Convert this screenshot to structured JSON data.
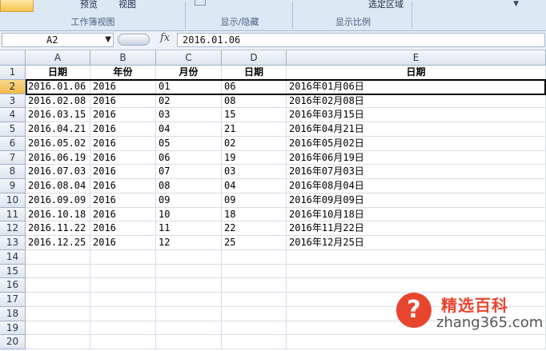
{
  "ribbon": {
    "groups": [
      {
        "label": "工作簿视图",
        "buttons": [
          "预览",
          "视图"
        ]
      },
      {
        "label": "显示/隐藏",
        "buttons": [
          ""
        ]
      },
      {
        "label": "显示比例",
        "buttons": [
          "选定区域"
        ]
      }
    ]
  },
  "formula_bar": {
    "name_box": "A2",
    "fx": "fx",
    "formula": "2016.01.06"
  },
  "columns": [
    "A",
    "B",
    "C",
    "D",
    "E"
  ],
  "row_numbers": [
    "1",
    "2",
    "3",
    "4",
    "5",
    "6",
    "7",
    "8",
    "9",
    "10",
    "11",
    "12",
    "13",
    "14",
    "15",
    "16",
    "17",
    "18",
    "19",
    "20"
  ],
  "header_row": [
    "日期",
    "年份",
    "月份",
    "日期",
    "日期"
  ],
  "data_rows": [
    [
      "2016.01.06",
      "2016",
      "01",
      "06",
      "2016年01月06日"
    ],
    [
      "2016.02.08",
      "2016",
      "02",
      "08",
      "2016年02月08日"
    ],
    [
      "2016.03.15",
      "2016",
      "03",
      "15",
      "2016年03月15日"
    ],
    [
      "2016.04.21",
      "2016",
      "04",
      "21",
      "2016年04月21日"
    ],
    [
      "2016.05.02",
      "2016",
      "05",
      "02",
      "2016年05月02日"
    ],
    [
      "2016.06.19",
      "2016",
      "06",
      "19",
      "2016年06月19日"
    ],
    [
      "2016.07.03",
      "2016",
      "07",
      "03",
      "2016年07月03日"
    ],
    [
      "2016.08.04",
      "2016",
      "08",
      "04",
      "2016年08月04日"
    ],
    [
      "2016.09.09",
      "2016",
      "09",
      "09",
      "2016年09月09日"
    ],
    [
      "2016.10.18",
      "2016",
      "10",
      "18",
      "2016年10月18日"
    ],
    [
      "2016.11.22",
      "2016",
      "11",
      "22",
      "2016年11月22日"
    ],
    [
      "2016.12.25",
      "2016",
      "12",
      "25",
      "2016年12月25日"
    ]
  ],
  "selected_row": "2",
  "watermark": {
    "icon": "question-mark-icon",
    "title": "精选百科",
    "url": "zhang365.com"
  },
  "colors": {
    "ribbon_bg": "#dde8f5",
    "selected_header": "#f0b94a",
    "watermark_red": "#e8452f"
  }
}
